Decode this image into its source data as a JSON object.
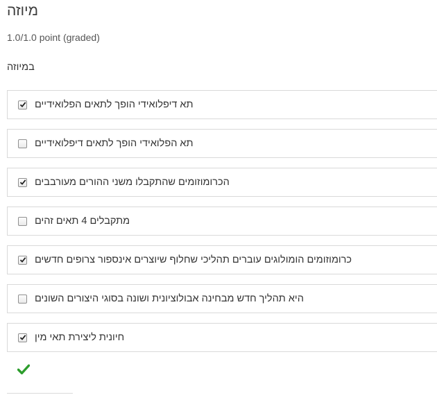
{
  "problem": {
    "title": "מיוזה",
    "score": "1.0/1.0 point (graded)",
    "question": "במיוזה"
  },
  "choices": [
    {
      "label": "תא דיפלואידי הופך לתאים הפלואידיים",
      "checked": true
    },
    {
      "label": "תא הפלואידי הופך לתאים דיפלואידיים",
      "checked": false
    },
    {
      "label": "הכרומוזומים שהתקבלו משני ההורים מעורבבים",
      "checked": true
    },
    {
      "label": "מתקבלים 4 תאים זהים",
      "checked": false
    },
    {
      "label": "כרומוזומים הומולוגים עוברים תהליכי שחלוף שיוצרים אינספור צרופים חדשים",
      "checked": true
    },
    {
      "label": "היא תהליך חדש מבחינה אבולוציונית ושונה בסוגי היצורים השונים",
      "checked": false
    },
    {
      "label": "חיונית ליצירת תאי מין",
      "checked": true
    }
  ],
  "feedback": {
    "icon": "checkmark-icon",
    "color": "#2d9d2d"
  }
}
